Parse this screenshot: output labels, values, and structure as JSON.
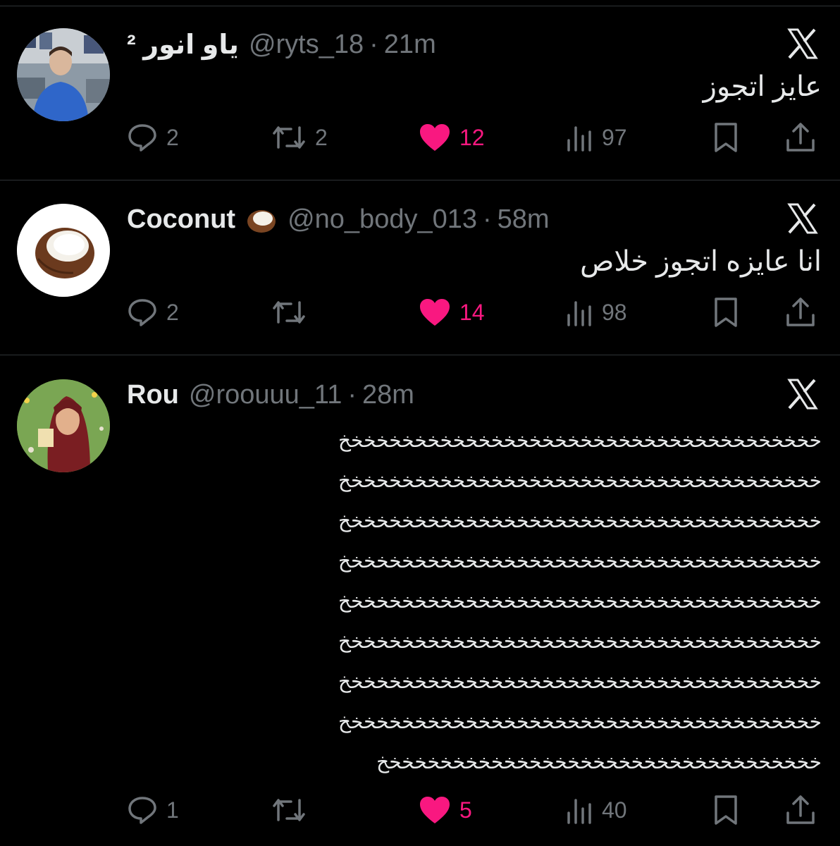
{
  "tweets": [
    {
      "name": "ياو انور ²",
      "handle": "@ryts_18",
      "time": "21m",
      "text": "عايز اتجوز",
      "replies": "2",
      "retweets": "2",
      "likes": "12",
      "views": "97",
      "avatar": "photo-person-blue-shirt"
    },
    {
      "name": "Coconut",
      "emoji": "coconut-emoji",
      "handle": "@no_body_013",
      "time": "58m",
      "text": "انا عايزه اتجوز خلاص",
      "replies": "2",
      "retweets": "",
      "likes": "14",
      "views": "98",
      "avatar": "coconut-image"
    },
    {
      "name": "Rou",
      "handle": "@roouuu_11",
      "time": "28m",
      "text_lines": [
        "خخخخخخخخخخخخخخخخخخخخخخخخخخخخخخخخخخخخخخ",
        "خخخخخخخخخخخخخخخخخخخخخخخخخخخخخخخخخخخخخخ",
        "خخخخخخخخخخخخخخخخخخخخخخخخخخخخخخخخخخخخخخ",
        "خخخخخخخخخخخخخخخخخخخخخخخخخخخخخخخخخخخخخخ",
        "خخخخخخخخخخخخخخخخخخخخخخخخخخخخخخخخخخخخخخ",
        "خخخخخخخخخخخخخخخخخخخخخخخخخخخخخخخخخخخخخخ",
        "خخخخخخخخخخخخخخخخخخخخخخخخخخخخخخخخخخخخخخ",
        "خخخخخخخخخخخخخخخخخخخخخخخخخخخخخخخخخخخخخخ",
        "خخخخخخخخخخخخخخخخخخخخخخخخخخخخخخخخخخخ"
      ],
      "replies": "1",
      "retweets": "",
      "likes": "5",
      "views": "40",
      "avatar": "cartoon-woman-hijab"
    }
  ],
  "colors": {
    "background": "#000000",
    "primary_text": "#e7e9ea",
    "secondary_text": "#71767b",
    "like_pink": "#f91880",
    "divider": "#2f3336"
  },
  "icons": [
    "reply-icon",
    "retweet-icon",
    "heart-icon",
    "views-icon",
    "bookmark-icon",
    "share-icon",
    "x-logo-icon"
  ]
}
